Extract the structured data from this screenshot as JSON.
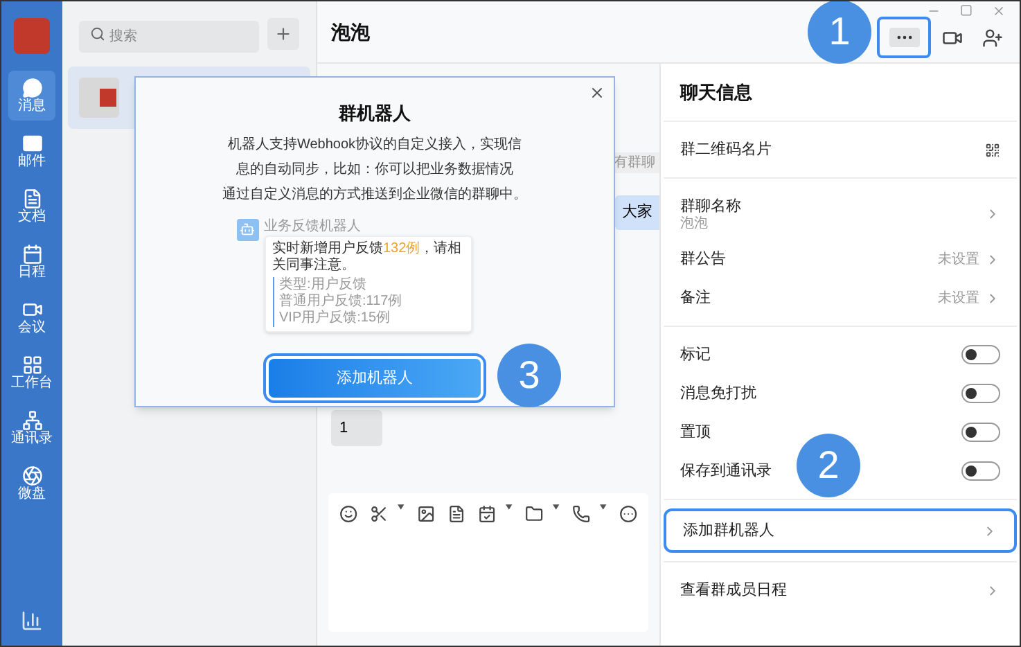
{
  "sidebar": {
    "items": [
      {
        "label": "消息",
        "selected": true
      },
      {
        "label": "邮件",
        "selected": false
      },
      {
        "label": "文档",
        "selected": false
      },
      {
        "label": "日程",
        "selected": false
      },
      {
        "label": "会议",
        "selected": false
      },
      {
        "label": "工作台",
        "selected": false
      },
      {
        "label": "通讯录",
        "selected": false
      },
      {
        "label": "微盘",
        "selected": false
      }
    ]
  },
  "search": {
    "placeholder": "搜索"
  },
  "chat_list": {
    "items": [
      {
        "selected": true
      }
    ]
  },
  "chat": {
    "title": "泡泡",
    "more_button": {
      "highlighted": true
    },
    "messages": [
      {
        "kind": "system",
        "text": "有群聊"
      },
      {
        "kind": "mine",
        "text": "大家"
      },
      {
        "kind": "other",
        "text": "1"
      }
    ]
  },
  "info_panel": {
    "title": "聊天信息",
    "sections": [
      {
        "rows": [
          {
            "kind": "qr",
            "label": "群二维码名片"
          }
        ]
      },
      {
        "rows": [
          {
            "kind": "nav",
            "label": "群聊名称",
            "subtitle": "泡泡"
          },
          {
            "kind": "nav",
            "label": "群公告",
            "value": "未设置"
          },
          {
            "kind": "nav",
            "label": "备注",
            "value": "未设置"
          }
        ]
      },
      {
        "rows": [
          {
            "kind": "toggle",
            "label": "标记",
            "on": false
          },
          {
            "kind": "toggle",
            "label": "消息免打扰",
            "on": false
          },
          {
            "kind": "toggle",
            "label": "置顶",
            "on": false
          },
          {
            "kind": "toggle",
            "label": "保存到通讯录",
            "on": false
          }
        ]
      },
      {
        "rows": [
          {
            "kind": "nav",
            "label": "添加群机器人",
            "highlighted": true
          }
        ]
      },
      {
        "rows": [
          {
            "kind": "nav",
            "label": "查看群成员日程"
          }
        ]
      }
    ]
  },
  "modal": {
    "title": "群机器人",
    "description_lines": [
      "机器人支持Webhook协议的自定义接入，实现信",
      "息的自动同步，比如：你可以把业务数据情况",
      "通过自定义消息的方式推送到企业微信的群聊中。"
    ],
    "preview": {
      "bot_name": "业务反馈机器人",
      "message_parts": [
        {
          "text": "实时新增用户反馈",
          "highlight": false
        },
        {
          "text": "132例",
          "highlight": true
        },
        {
          "text": "，请相关同事注意。",
          "highlight": false
        }
      ],
      "quote_lines": [
        "类型:用户反馈",
        "普通用户反馈:117例",
        "VIP用户反馈:15例"
      ]
    },
    "button": {
      "label": "添加机器人",
      "highlighted": true
    }
  },
  "callouts": [
    {
      "number": "1",
      "kind": "more_button"
    },
    {
      "number": "2",
      "kind": "robot_row"
    },
    {
      "number": "3",
      "kind": "add_button"
    }
  ]
}
